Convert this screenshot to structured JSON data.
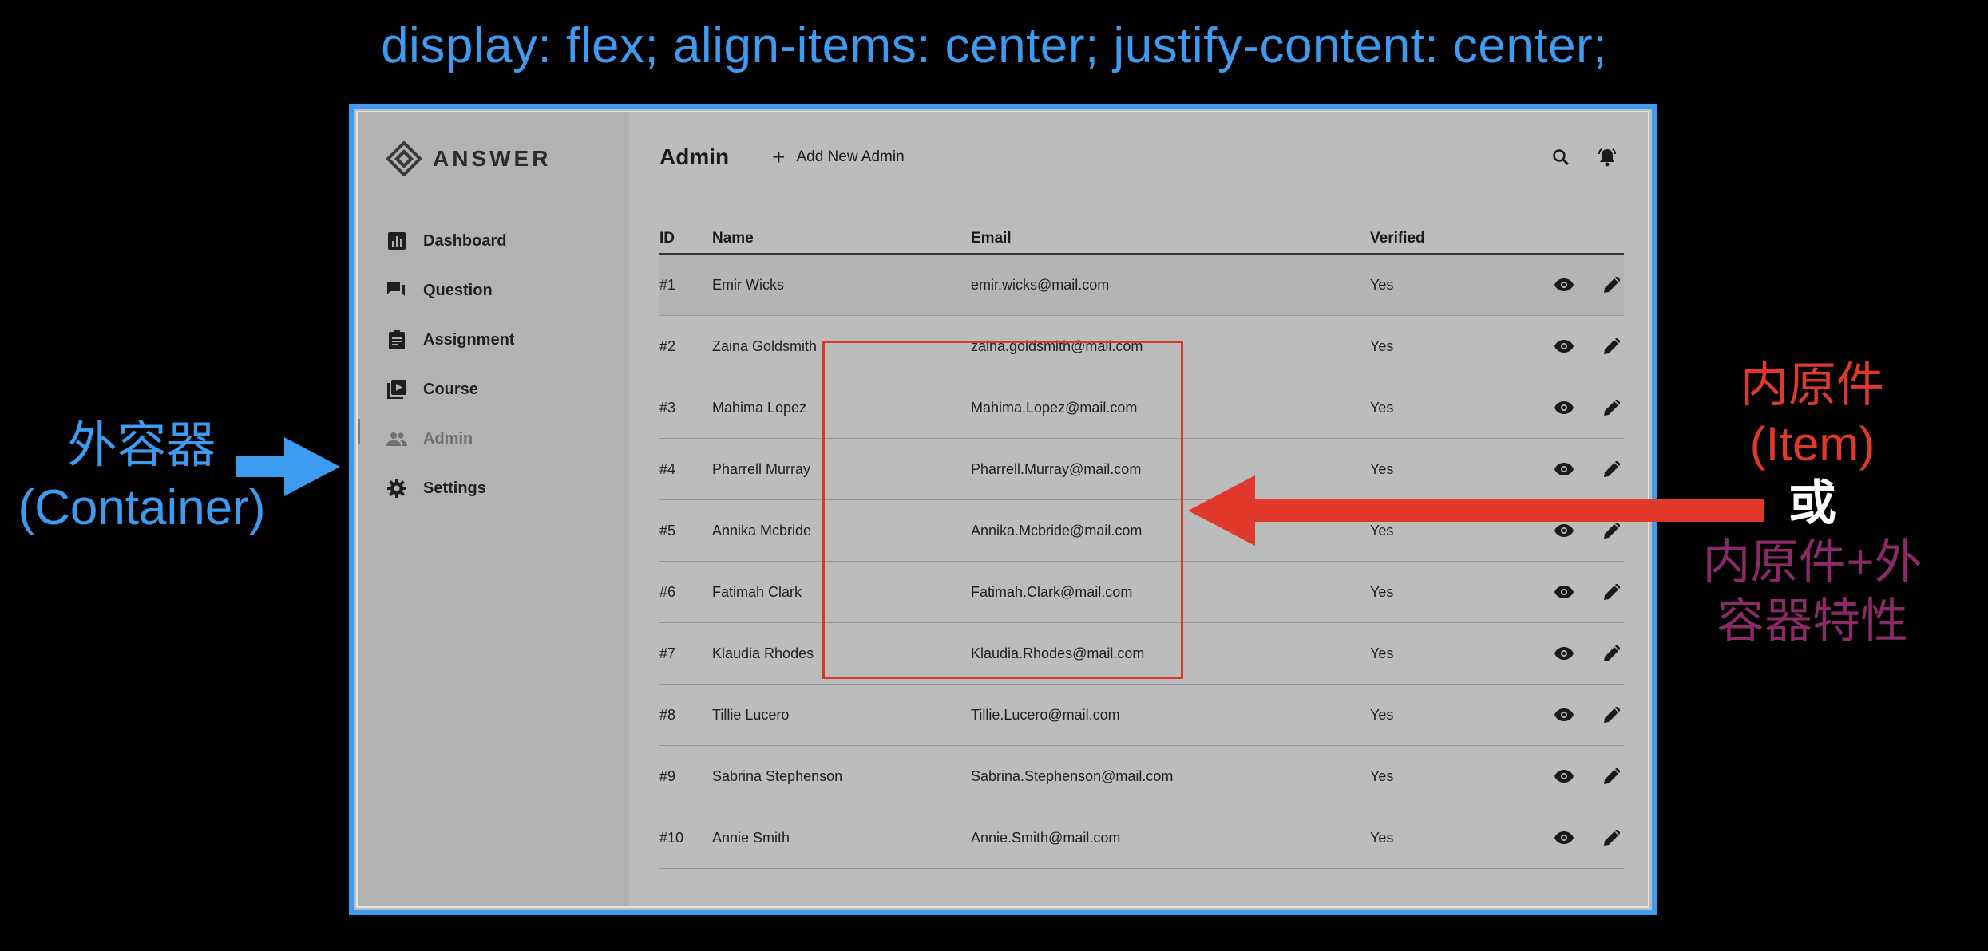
{
  "annotation": {
    "code": "display: flex; align-items: center; justify-content: center;",
    "container_label_cn": "外容器",
    "container_label_en": "(Container)",
    "item_label_cn": "内原件",
    "item_label_en": "(Item)",
    "or_label": "或",
    "item_plus_line1": "内原件+外",
    "item_plus_line2": "容器特性",
    "colors": {
      "blue": "#3d9bf0",
      "red": "#e0382a",
      "purple": "#8a2a68"
    }
  },
  "app": {
    "logo_text": "ANSWER",
    "nav": [
      {
        "label": "Dashboard",
        "icon": "bar-chart-icon"
      },
      {
        "label": "Question",
        "icon": "forum-icon"
      },
      {
        "label": "Assignment",
        "icon": "clipboard-icon"
      },
      {
        "label": "Course",
        "icon": "video-library-icon"
      },
      {
        "label": "Admin",
        "icon": "people-icon",
        "active": true
      },
      {
        "label": "Settings",
        "icon": "gear-icon"
      }
    ],
    "header": {
      "title": "Admin",
      "add_button": "Add New Admin"
    },
    "table": {
      "columns": {
        "id": "ID",
        "name": "Name",
        "email": "Email",
        "verified": "Verified"
      },
      "rows": [
        {
          "id": "#1",
          "name": "Emir Wicks",
          "email": "emir.wicks@mail.com",
          "verified": "Yes"
        },
        {
          "id": "#2",
          "name": "Zaina Goldsmith",
          "email": "zaina.goldsmith@mail.com",
          "verified": "Yes"
        },
        {
          "id": "#3",
          "name": "Mahima Lopez",
          "email": "Mahima.Lopez@mail.com",
          "verified": "Yes"
        },
        {
          "id": "#4",
          "name": "Pharrell Murray",
          "email": "Pharrell.Murray@mail.com",
          "verified": "Yes"
        },
        {
          "id": "#5",
          "name": "Annika Mcbride",
          "email": "Annika.Mcbride@mail.com",
          "verified": "Yes"
        },
        {
          "id": "#6",
          "name": "Fatimah Clark",
          "email": "Fatimah.Clark@mail.com",
          "verified": "Yes"
        },
        {
          "id": "#7",
          "name": "Klaudia Rhodes",
          "email": "Klaudia.Rhodes@mail.com",
          "verified": "Yes"
        },
        {
          "id": "#8",
          "name": "Tillie Lucero",
          "email": "Tillie.Lucero@mail.com",
          "verified": "Yes"
        },
        {
          "id": "#9",
          "name": "Sabrina Stephenson",
          "email": "Sabrina.Stephenson@mail.com",
          "verified": "Yes"
        },
        {
          "id": "#10",
          "name": "Annie Smith",
          "email": "Annie.Smith@mail.com",
          "verified": "Yes"
        }
      ]
    }
  }
}
